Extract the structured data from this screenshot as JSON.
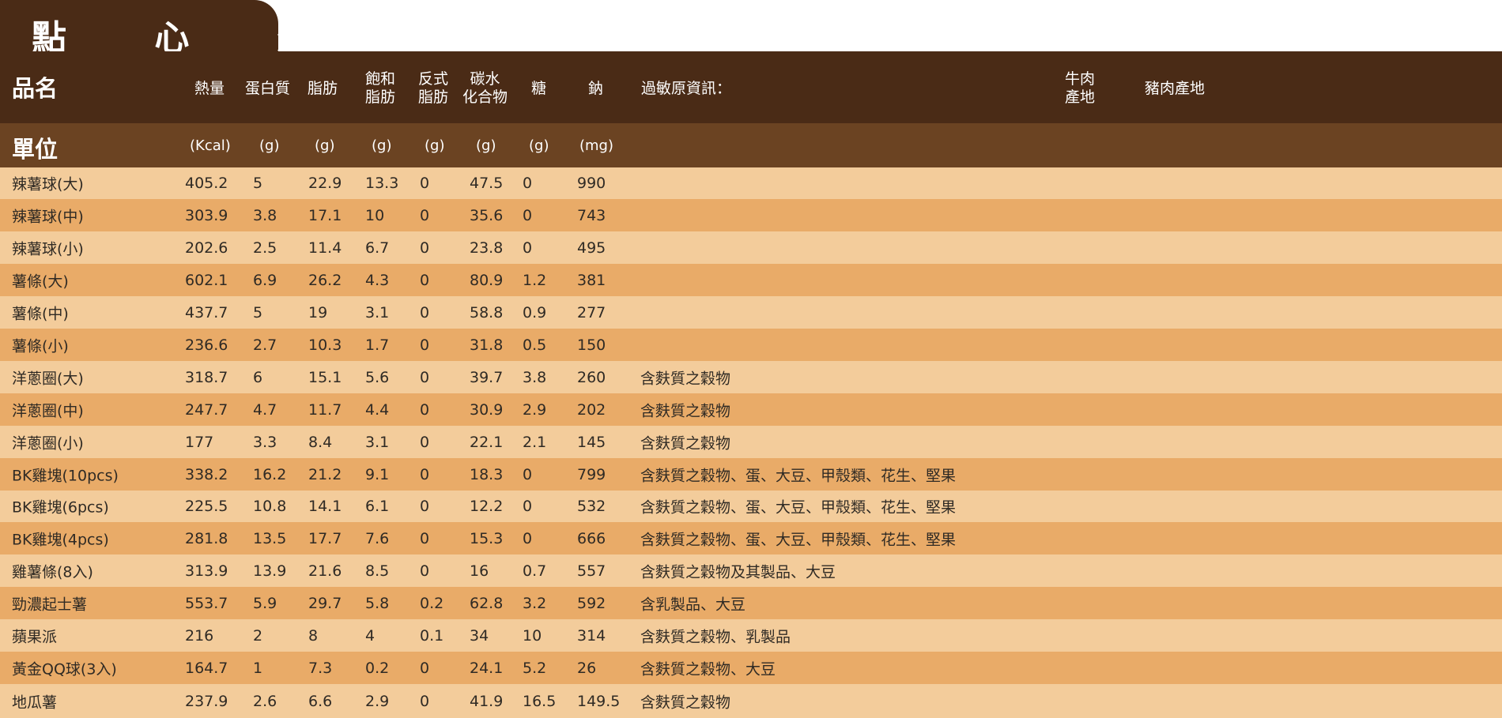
{
  "title": "點 心 類",
  "header": {
    "name_label": "品名",
    "unit_label": "單位",
    "columns": [
      {
        "label": "熱量",
        "unit": "(Kcal)"
      },
      {
        "label": "蛋白質",
        "unit": "(g)"
      },
      {
        "label": "脂肪",
        "unit": "(g)"
      },
      {
        "label": "飽和\n脂肪",
        "unit": "(g)"
      },
      {
        "label": "反式\n脂肪",
        "unit": "(g)"
      },
      {
        "label": "碳水\n化合物",
        "unit": "(g)"
      },
      {
        "label": "糖",
        "unit": "(g)"
      },
      {
        "label": "鈉",
        "unit": "(mg)"
      }
    ],
    "allergen_label": "過敏原資訊：",
    "beef_origin_label": "牛肉\n產地",
    "pork_origin_label": "豬肉產地"
  },
  "rows": [
    {
      "name": "辣薯球(大)",
      "values": [
        "405.2",
        "5",
        "22.9",
        "13.3",
        "0",
        "47.5",
        "0",
        "990"
      ],
      "allergen": ""
    },
    {
      "name": "辣薯球(中)",
      "values": [
        "303.9",
        "3.8",
        "17.1",
        "10",
        "0",
        "35.6",
        "0",
        "743"
      ],
      "allergen": ""
    },
    {
      "name": "辣薯球(小)",
      "values": [
        "202.6",
        "2.5",
        "11.4",
        "6.7",
        "0",
        "23.8",
        "0",
        "495"
      ],
      "allergen": ""
    },
    {
      "name": "薯條(大)",
      "values": [
        "602.1",
        "6.9",
        "26.2",
        "4.3",
        "0",
        "80.9",
        "1.2",
        "381"
      ],
      "allergen": ""
    },
    {
      "name": "薯條(中)",
      "values": [
        "437.7",
        "5",
        "19",
        "3.1",
        "0",
        "58.8",
        "0.9",
        "277"
      ],
      "allergen": ""
    },
    {
      "name": "薯條(小)",
      "values": [
        "236.6",
        "2.7",
        "10.3",
        "1.7",
        "0",
        "31.8",
        "0.5",
        "150"
      ],
      "allergen": ""
    },
    {
      "name": "洋蔥圈(大)",
      "values": [
        "318.7",
        "6",
        "15.1",
        "5.6",
        "0",
        "39.7",
        "3.8",
        "260"
      ],
      "allergen": "含麩質之穀物"
    },
    {
      "name": "洋蔥圈(中)",
      "values": [
        "247.7",
        "4.7",
        "11.7",
        "4.4",
        "0",
        "30.9",
        "2.9",
        "202"
      ],
      "allergen": "含麩質之穀物"
    },
    {
      "name": "洋蔥圈(小)",
      "values": [
        "177",
        "3.3",
        "8.4",
        "3.1",
        "0",
        "22.1",
        "2.1",
        "145"
      ],
      "allergen": "含麩質之穀物"
    },
    {
      "name": "BK雞塊(10pcs)",
      "values": [
        "338.2",
        "16.2",
        "21.2",
        "9.1",
        "0",
        "18.3",
        "0",
        "799"
      ],
      "allergen": "含麩質之穀物、蛋、大豆、甲殼類、花生、堅果"
    },
    {
      "name": "BK雞塊(6pcs)",
      "values": [
        "225.5",
        "10.8",
        "14.1",
        "6.1",
        "0",
        "12.2",
        "0",
        "532"
      ],
      "allergen": "含麩質之穀物、蛋、大豆、甲殼類、花生、堅果"
    },
    {
      "name": "BK雞塊(4pcs)",
      "values": [
        "281.8",
        "13.5",
        "17.7",
        "7.6",
        "0",
        "15.3",
        "0",
        "666"
      ],
      "allergen": "含麩質之穀物、蛋、大豆、甲殼類、花生、堅果"
    },
    {
      "name": "雞薯條(8入)",
      "values": [
        "313.9",
        "13.9",
        "21.6",
        "8.5",
        "0",
        "16",
        "0.7",
        "557"
      ],
      "allergen": "含麩質之穀物及其製品、大豆"
    },
    {
      "name": "勁濃起士薯",
      "values": [
        "553.7",
        "5.9",
        "29.7",
        "5.8",
        "0.2",
        "62.8",
        "3.2",
        "592"
      ],
      "allergen": "含乳製品、大豆"
    },
    {
      "name": "蘋果派",
      "values": [
        "216",
        "2",
        "8",
        "4",
        "0.1",
        "34",
        "10",
        "314"
      ],
      "allergen": "含麩質之穀物、乳製品"
    },
    {
      "name": "黃金QQ球(3入)",
      "values": [
        "164.7",
        "1",
        "7.3",
        "0.2",
        "0",
        "24.1",
        "5.2",
        "26"
      ],
      "allergen": "含麩質之穀物、大豆"
    },
    {
      "name": "地瓜薯",
      "values": [
        "237.9",
        "2.6",
        "6.6",
        "2.9",
        "0",
        "41.9",
        "16.5",
        "149.5"
      ],
      "allergen": "含麩質之穀物"
    }
  ]
}
